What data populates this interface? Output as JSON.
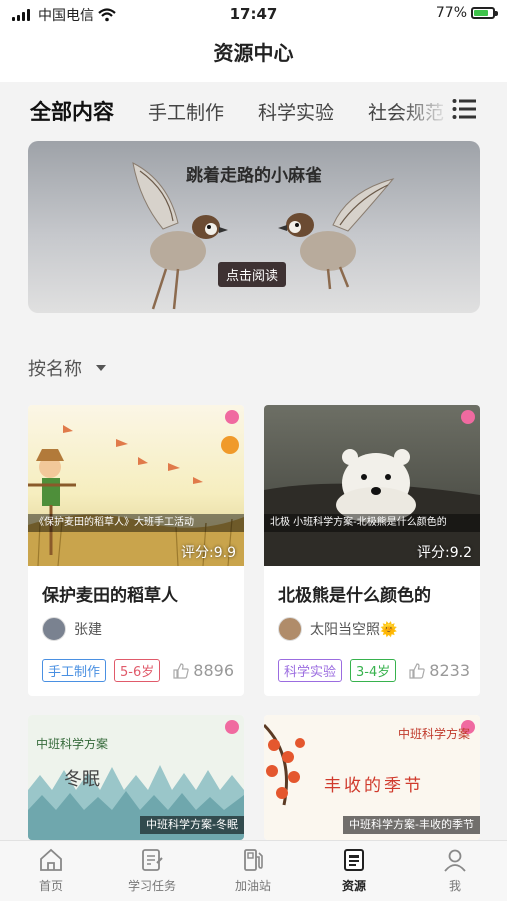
{
  "status": {
    "carrier": "中国电信",
    "time": "17:47",
    "battery": "77%"
  },
  "header": {
    "title": "资源中心"
  },
  "tabs": [
    {
      "label": "全部内容"
    },
    {
      "label": "手工制作"
    },
    {
      "label": "科学实验"
    },
    {
      "label": "社会规范"
    }
  ],
  "banner": {
    "title": "跳着走路的小麻雀",
    "button": "点击阅读"
  },
  "sort": {
    "label": "按名称"
  },
  "cards": [
    {
      "caption": "《保护麦田的稻草人》大班手工活动",
      "score": "评分:9.9",
      "title": "保护麦田的稻草人",
      "author": "张建",
      "tag1": "手工制作",
      "tag2": "5-6岁",
      "likes": "8896"
    },
    {
      "caption": "北极  小班科学方案-北极熊是什么颜色的",
      "score": "评分:9.2",
      "title": "北极熊是什么颜色的",
      "author": "太阳当空照🌞",
      "tag1": "科学实验",
      "tag2": "3-4岁",
      "likes": "8233"
    },
    {
      "top_label": "中班科学方案",
      "art_title": "冬眠",
      "caption": "中班科学方案-冬眠"
    },
    {
      "top_label": "中班科学方案",
      "art_title": "丰收的季节",
      "caption": "中班科学方案-丰收的季节"
    }
  ],
  "tabbar": [
    {
      "label": "首页",
      "icon": "home-icon"
    },
    {
      "label": "学习任务",
      "icon": "task-icon"
    },
    {
      "label": "加油站",
      "icon": "fuel-icon"
    },
    {
      "label": "资源",
      "icon": "resource-icon"
    },
    {
      "label": "我",
      "icon": "user-icon"
    }
  ],
  "colors": {
    "tag_handcraft": "#4a90e2",
    "tag_age_red": "#e05a6a",
    "tag_science": "#9b6ce0",
    "tag_age_green": "#37b24d"
  }
}
